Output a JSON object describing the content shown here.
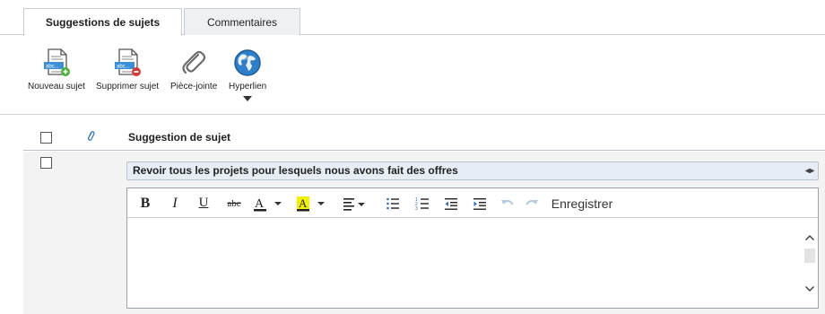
{
  "tabs": [
    {
      "label": "Suggestions de sujets",
      "active": true
    },
    {
      "label": "Commentaires",
      "active": false
    }
  ],
  "ribbon": {
    "new_topic": "Nouveau sujet",
    "delete_topic": "Supprimer sujet",
    "attachment": "Pièce-jointe",
    "hyperlink": "Hyperlien"
  },
  "grid": {
    "column_title": "Suggestion de sujet",
    "row": {
      "subject": "Revoir tous les projets pour lesquels nous avons fait des offres"
    }
  },
  "editor": {
    "save_label": "Enregistrer",
    "body_text": ""
  },
  "colors": {
    "text_color_swatch": "#222222",
    "highlight_swatch": "#f2f200",
    "subject_bg": "#e7edf4"
  }
}
